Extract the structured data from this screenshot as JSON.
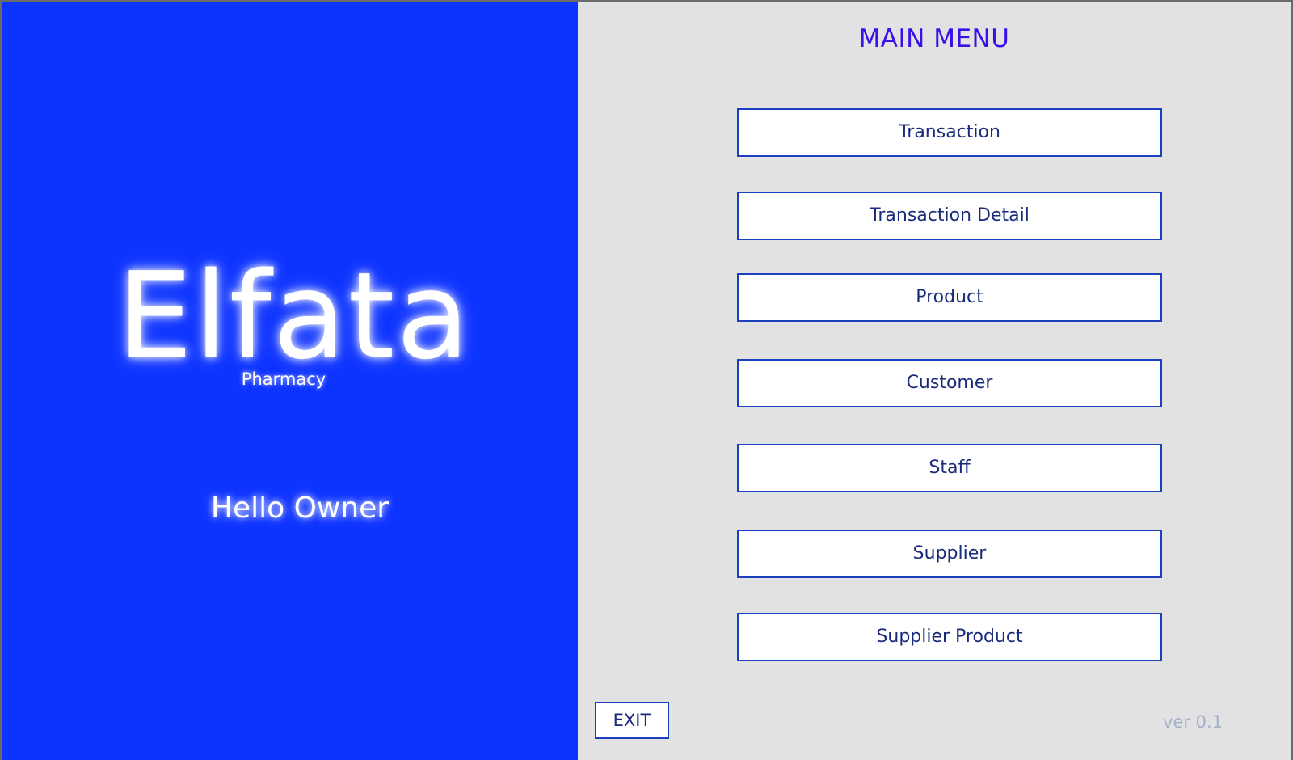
{
  "brand": {
    "name": "Elfata",
    "subtitle": "Pharmacy",
    "greeting": "Hello Owner"
  },
  "menu": {
    "title": "MAIN MENU",
    "items": [
      {
        "label": "Transaction"
      },
      {
        "label": "Transaction Detail"
      },
      {
        "label": "Product"
      },
      {
        "label": "Customer"
      },
      {
        "label": "Staff"
      },
      {
        "label": "Supplier"
      },
      {
        "label": "Supplier Product"
      }
    ]
  },
  "footer": {
    "exit_label": "EXIT",
    "version": "ver 0.1"
  },
  "colors": {
    "brand_blue": "#0d33ff",
    "panel_gray": "#e2e2e2",
    "title_purple": "#3a10e6",
    "button_border": "#1a3fbf"
  }
}
